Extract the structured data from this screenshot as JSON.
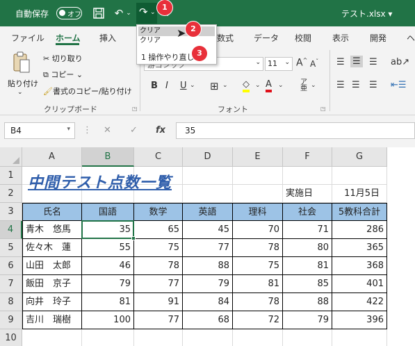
{
  "titlebar": {
    "autosave_label": "自動保存",
    "toggle_state": "オフ",
    "filename": "テスト.xlsx"
  },
  "tabs": [
    "ファイル",
    "ホーム",
    "挿入",
    "数式",
    "データ",
    "校閲",
    "表示",
    "開発"
  ],
  "active_tab": "ホーム",
  "undo_dropdown": {
    "items": [
      "クリア",
      "クリア"
    ],
    "summary": "1 操作やり直し"
  },
  "badges": [
    "1",
    "2",
    "3"
  ],
  "ribbon": {
    "clipboard": {
      "paste": "貼り付け",
      "cut": "切り取り",
      "copy": "コピー",
      "format_painter": "書式のコピー/貼り付け",
      "label": "クリップボード"
    },
    "font": {
      "font_name": "游ゴシック",
      "font_size": "11",
      "label": "フォント"
    }
  },
  "formula_bar": {
    "name_box": "B4",
    "value": "35"
  },
  "sheet": {
    "columns": [
      "A",
      "B",
      "C",
      "D",
      "E",
      "F",
      "G"
    ],
    "rows": [
      "1",
      "2",
      "3",
      "4",
      "5",
      "6",
      "7",
      "8",
      "9",
      "10"
    ],
    "title": "中間テスト点数一覧",
    "date_label": "実施日",
    "date_value": "11月5日",
    "headers": [
      "氏名",
      "国語",
      "数学",
      "英語",
      "理科",
      "社会",
      "5教科合計"
    ],
    "records": [
      [
        "青木　悠馬",
        "35",
        "65",
        "45",
        "70",
        "71",
        "286"
      ],
      [
        "佐々木　蓮",
        "55",
        "75",
        "77",
        "78",
        "80",
        "365"
      ],
      [
        "山田　太郎",
        "46",
        "78",
        "88",
        "75",
        "81",
        "368"
      ],
      [
        "飯田　京子",
        "79",
        "77",
        "79",
        "81",
        "85",
        "401"
      ],
      [
        "向井　玲子",
        "81",
        "91",
        "84",
        "78",
        "88",
        "422"
      ],
      [
        "吉川　瑞樹",
        "100",
        "77",
        "68",
        "72",
        "79",
        "396"
      ]
    ]
  },
  "colors": {
    "excel_green": "#217346",
    "header_fill": "#9dc3e6",
    "badge_red": "#e8303a",
    "title_blue": "#2f5eab"
  }
}
